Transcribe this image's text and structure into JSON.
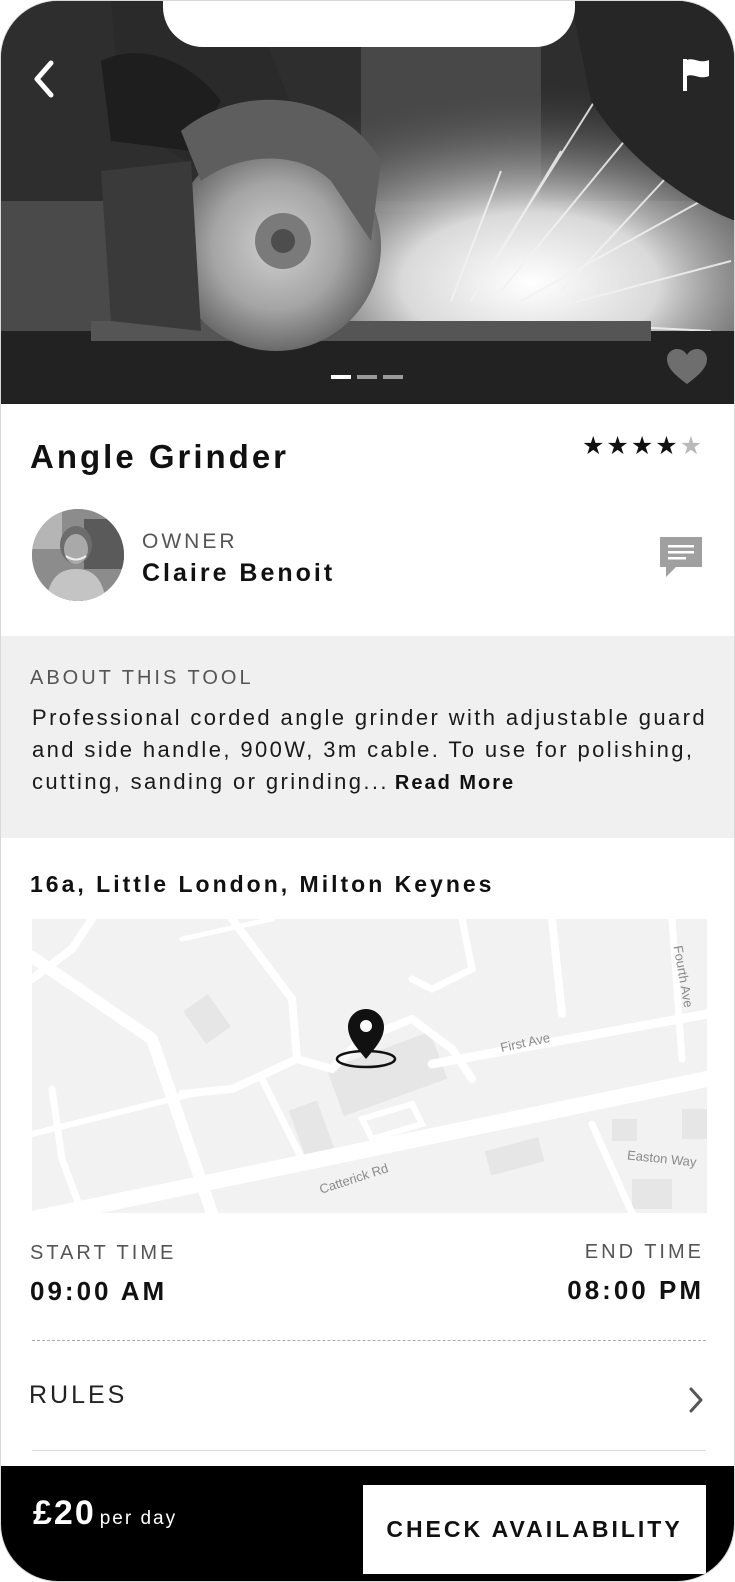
{
  "listing": {
    "title": "Angle Grinder",
    "rating": {
      "value": 4,
      "max": 5
    }
  },
  "owner": {
    "label": "OWNER",
    "name": "Claire Benoit"
  },
  "about": {
    "label": "ABOUT THIS TOOL",
    "text": "Professional corded angle grinder with adjustable guard and side handle, 900W, 3m cable. To use for polishing, cutting, sanding or grinding...",
    "read_more": "Read More"
  },
  "location": {
    "address": "16a, Little London, Milton Keynes",
    "map_labels": {
      "road1": "First Ave",
      "road2": "Catterick Rd",
      "road3": "Easton Way",
      "road4": "Fourth Ave"
    }
  },
  "schedule": {
    "start_label": "START TIME",
    "start_value": "09:00 AM",
    "end_label": "END TIME",
    "end_value": "08:00 PM"
  },
  "rules": {
    "label": "RULES"
  },
  "gallery": {
    "image_count": 3,
    "active_index": 0
  },
  "footer": {
    "price": "£20",
    "price_unit": "per day",
    "cta": "CHECK AVAILABILITY"
  },
  "icons": {
    "back": "chevron-left-icon",
    "report": "flag-icon",
    "favorite": "heart-icon",
    "message": "chat-bubble-icon",
    "map_pin": "map-pin-icon",
    "rules": "chevron-right-icon"
  },
  "colors": {
    "footer_bg": "#000000",
    "section_bg": "#f0f0f0",
    "star_on": "#111111",
    "star_off": "#b9b9b9"
  }
}
